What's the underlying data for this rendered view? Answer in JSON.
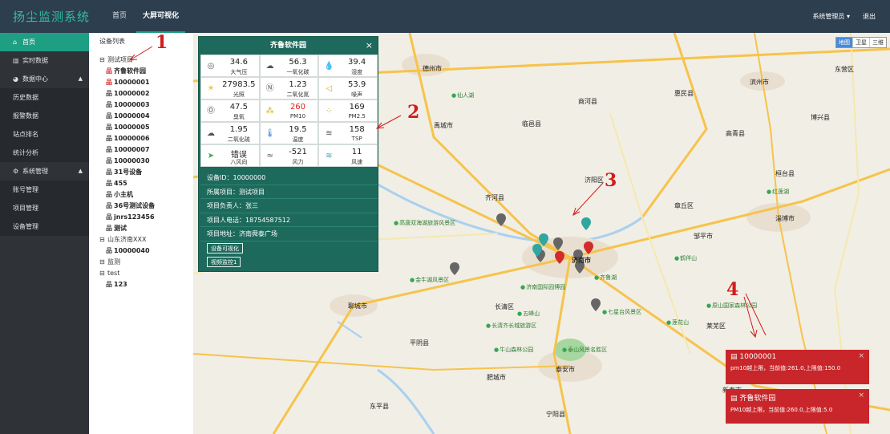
{
  "header": {
    "brand": "扬尘监测系统",
    "nav": [
      "首页",
      "大屏可视化"
    ],
    "user": "系统管理员 ▾",
    "logout": "退出"
  },
  "sidebar": {
    "items": [
      {
        "label": "首页",
        "icon": "home-icon"
      },
      {
        "label": "实时数据",
        "icon": "chart-icon"
      },
      {
        "label": "数据中心",
        "icon": "pie-icon"
      },
      {
        "label": "历史数据"
      },
      {
        "label": "报警数据"
      },
      {
        "label": "站点排名"
      },
      {
        "label": "统计分析"
      },
      {
        "label": "系统管理",
        "icon": "gear-icon"
      },
      {
        "label": "账号管理"
      },
      {
        "label": "项目管理"
      },
      {
        "label": "设备管理"
      }
    ]
  },
  "tree": {
    "title": "设备列表",
    "rows": [
      {
        "label": "测试项目",
        "type": "folder"
      },
      {
        "label": "齐鲁软件园",
        "type": "red"
      },
      {
        "label": "10000001",
        "type": "red"
      },
      {
        "label": "10000002",
        "type": "dev"
      },
      {
        "label": "10000003",
        "type": "dev"
      },
      {
        "label": "10000004",
        "type": "dev"
      },
      {
        "label": "10000005",
        "type": "dev"
      },
      {
        "label": "10000006",
        "type": "dev"
      },
      {
        "label": "10000007",
        "type": "dev"
      },
      {
        "label": "10000030",
        "type": "dev"
      },
      {
        "label": "31号设备",
        "type": "dev"
      },
      {
        "label": "455",
        "type": "dev"
      },
      {
        "label": "小主机",
        "type": "dev"
      },
      {
        "label": "36号测试设备",
        "type": "dev"
      },
      {
        "label": "jnrs123456",
        "type": "dev"
      },
      {
        "label": "测试",
        "type": "dev"
      },
      {
        "label": "山东济南XXX",
        "type": "folder"
      },
      {
        "label": "10000040",
        "type": "dev"
      },
      {
        "label": "监测",
        "type": "folder"
      },
      {
        "label": "test",
        "type": "folder"
      },
      {
        "label": "123",
        "type": "dev"
      }
    ]
  },
  "panel": {
    "title": "齐鲁软件园",
    "close": "×",
    "metrics": [
      {
        "value": "34.6",
        "label": "大气压",
        "icon": "pressure-icon"
      },
      {
        "value": "56.3",
        "label": "一氧化碳",
        "icon": "co-icon"
      },
      {
        "value": "39.4",
        "label": "湿度",
        "icon": "humidity-icon"
      },
      {
        "value": "27983.5",
        "label": "光照",
        "icon": "sun-icon"
      },
      {
        "value": "1.23",
        "label": "二氧化氮",
        "icon": "no2-icon"
      },
      {
        "value": "53.9",
        "label": "噪声",
        "icon": "speaker-icon"
      },
      {
        "value": "47.5",
        "label": "臭氧",
        "icon": "o3-icon"
      },
      {
        "value": "260",
        "label": "PM10",
        "icon": "pm10-icon",
        "alert": true
      },
      {
        "value": "169",
        "label": "PM2.5",
        "icon": "pm25-icon"
      },
      {
        "value": "1.95",
        "label": "二氧化硫",
        "icon": "so2-icon"
      },
      {
        "value": "19.5",
        "label": "温度",
        "icon": "thermometer-icon"
      },
      {
        "value": "158",
        "label": "TSP",
        "icon": "tsp-icon"
      },
      {
        "value": "错误",
        "label": "八风向",
        "icon": "direction-icon"
      },
      {
        "value": "-521",
        "label": "风力",
        "icon": "wind-force-icon"
      },
      {
        "value": "11",
        "label": "风速",
        "icon": "wind-speed-icon"
      }
    ],
    "info": [
      "设备ID：10000000",
      "所属项目：测试项目",
      "项目负责人：张三",
      "项目人电话：18754587512",
      "项目地址：济南舜泰广场"
    ],
    "buttons": [
      "设备可视化",
      "视频监控1"
    ]
  },
  "map": {
    "types": [
      "地图",
      "卫星",
      "三维"
    ],
    "cities": [
      "德州市",
      "滨州市",
      "济南市",
      "淄博市",
      "聊城市",
      "泰安市",
      "济阳区",
      "东营区",
      "邹平市",
      "章丘区",
      "长清区",
      "肥城市",
      "平阴县",
      "齐河县",
      "禹城市",
      "临邑县",
      "商河县",
      "惠民县",
      "高青县",
      "桓台县",
      "博兴县",
      "东平县",
      "宁阳县",
      "新泰市",
      "莱芜区"
    ],
    "pois": [
      "仙人湖",
      "高唐双海湖旅游风景区",
      "金牛湖风景区",
      "济南国际园博园",
      "长清齐长城旅游区",
      "五峰山",
      "牛山森林公园",
      "泰山风景名胜区",
      "七星台风景区",
      "莲花山",
      "原山国家森林公园",
      "齐鲁湖",
      "红莲湖",
      "鹤伴山"
    ]
  },
  "alerts": [
    {
      "title": "10000001",
      "message": "pm10越上限，当前值:261.0,上限值:150.0",
      "close": "×"
    },
    {
      "title": "齐鲁软件园",
      "message": "PM10越上限，当前值:260.0,上限值:5.0",
      "close": "×"
    }
  ],
  "annotations": [
    "1",
    "2",
    "3",
    "4"
  ]
}
